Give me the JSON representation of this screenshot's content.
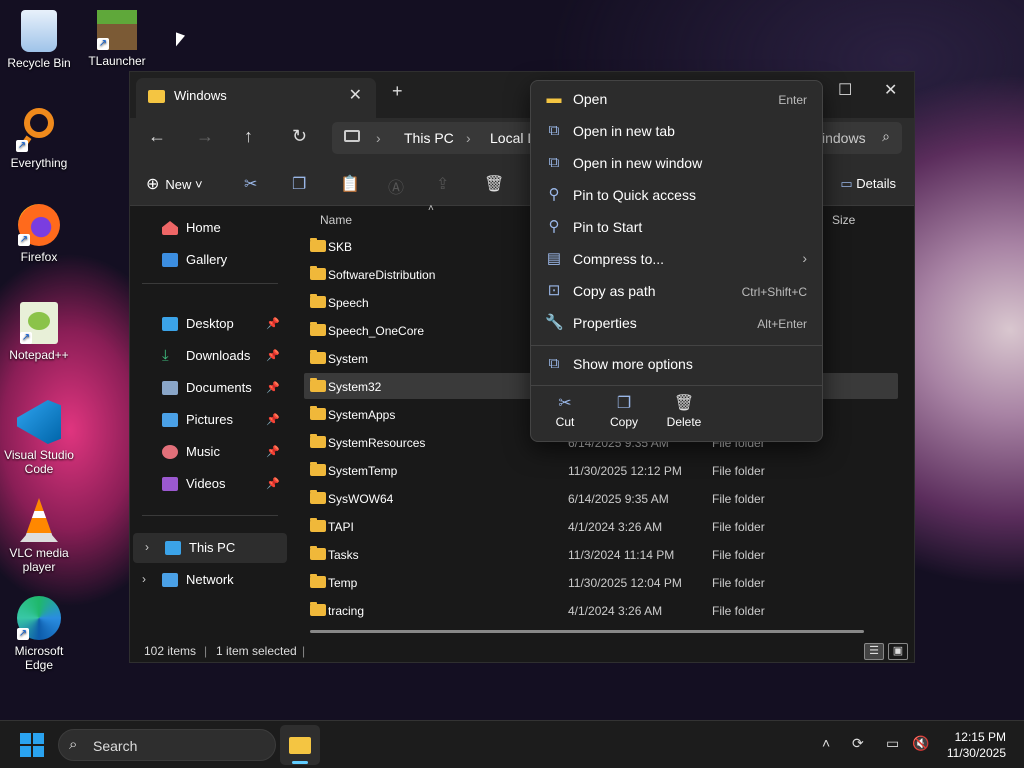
{
  "desktop": {
    "icons": [
      {
        "label": "Recycle Bin",
        "icon": "recycle-bin-icon"
      },
      {
        "label": "TLauncher",
        "icon": "tlauncher-icon"
      },
      {
        "label": "Everything",
        "icon": "everything-icon"
      },
      {
        "label": "Firefox",
        "icon": "firefox-icon"
      },
      {
        "label": "Notepad++",
        "icon": "notepadpp-icon"
      },
      {
        "label": "Visual Studio Code",
        "icon": "vscode-icon"
      },
      {
        "label": "VLC media player",
        "icon": "vlc-icon"
      },
      {
        "label": "Microsoft Edge",
        "icon": "edge-icon"
      }
    ]
  },
  "explorer": {
    "tab_title": "Windows",
    "breadcrumb": [
      "This PC",
      "Local D"
    ],
    "search_text": "indows",
    "toolbar": {
      "new_label": "New",
      "details_label": "Details"
    },
    "nav": {
      "home": "Home",
      "gallery": "Gallery",
      "desktop": "Desktop",
      "downloads": "Downloads",
      "documents": "Documents",
      "pictures": "Pictures",
      "music": "Music",
      "videos": "Videos",
      "this_pc": "This PC",
      "network": "Network"
    },
    "columns": {
      "name": "Name",
      "size": "Size"
    },
    "files": [
      {
        "name": "SKB",
        "date": "",
        "type": ""
      },
      {
        "name": "SoftwareDistribution",
        "date": "",
        "type": ""
      },
      {
        "name": "Speech",
        "date": "",
        "type": ""
      },
      {
        "name": "Speech_OneCore",
        "date": "",
        "type": ""
      },
      {
        "name": "System",
        "date": "",
        "type": ""
      },
      {
        "name": "System32",
        "date": "",
        "type": ""
      },
      {
        "name": "SystemApps",
        "date": "",
        "type": ""
      },
      {
        "name": "SystemResources",
        "date": "6/14/2025 9:35 AM",
        "type": "File folder"
      },
      {
        "name": "SystemTemp",
        "date": "11/30/2025 12:12 PM",
        "type": "File folder"
      },
      {
        "name": "SysWOW64",
        "date": "6/14/2025 9:35 AM",
        "type": "File folder"
      },
      {
        "name": "TAPI",
        "date": "4/1/2024 3:26 AM",
        "type": "File folder"
      },
      {
        "name": "Tasks",
        "date": "11/3/2024 11:14 PM",
        "type": "File folder"
      },
      {
        "name": "Temp",
        "date": "11/30/2025 12:04 PM",
        "type": "File folder"
      },
      {
        "name": "tracing",
        "date": "4/1/2024 3:26 AM",
        "type": "File folder"
      }
    ],
    "status": {
      "count": "102 items",
      "selected": "1 item selected"
    }
  },
  "context_menu": {
    "items": [
      {
        "label": "Open",
        "shortcut": "Enter",
        "icon": "folder-icon"
      },
      {
        "label": "Open in new tab",
        "shortcut": "",
        "icon": "new-tab-icon"
      },
      {
        "label": "Open in new window",
        "shortcut": "",
        "icon": "new-window-icon"
      },
      {
        "label": "Pin to Quick access",
        "shortcut": "",
        "icon": "pin-icon"
      },
      {
        "label": "Pin to Start",
        "shortcut": "",
        "icon": "pin-icon"
      },
      {
        "label": "Compress to...",
        "shortcut": "",
        "icon": "zip-icon"
      },
      {
        "label": "Copy as path",
        "shortcut": "Ctrl+Shift+C",
        "icon": "path-icon"
      },
      {
        "label": "Properties",
        "shortcut": "Alt+Enter",
        "icon": "wrench-icon"
      }
    ],
    "more": "Show more options",
    "quick": {
      "cut": "Cut",
      "copy": "Copy",
      "delete": "Delete"
    }
  },
  "taskbar": {
    "search": "Search",
    "time": "12:15 PM",
    "date": "11/30/2025"
  }
}
